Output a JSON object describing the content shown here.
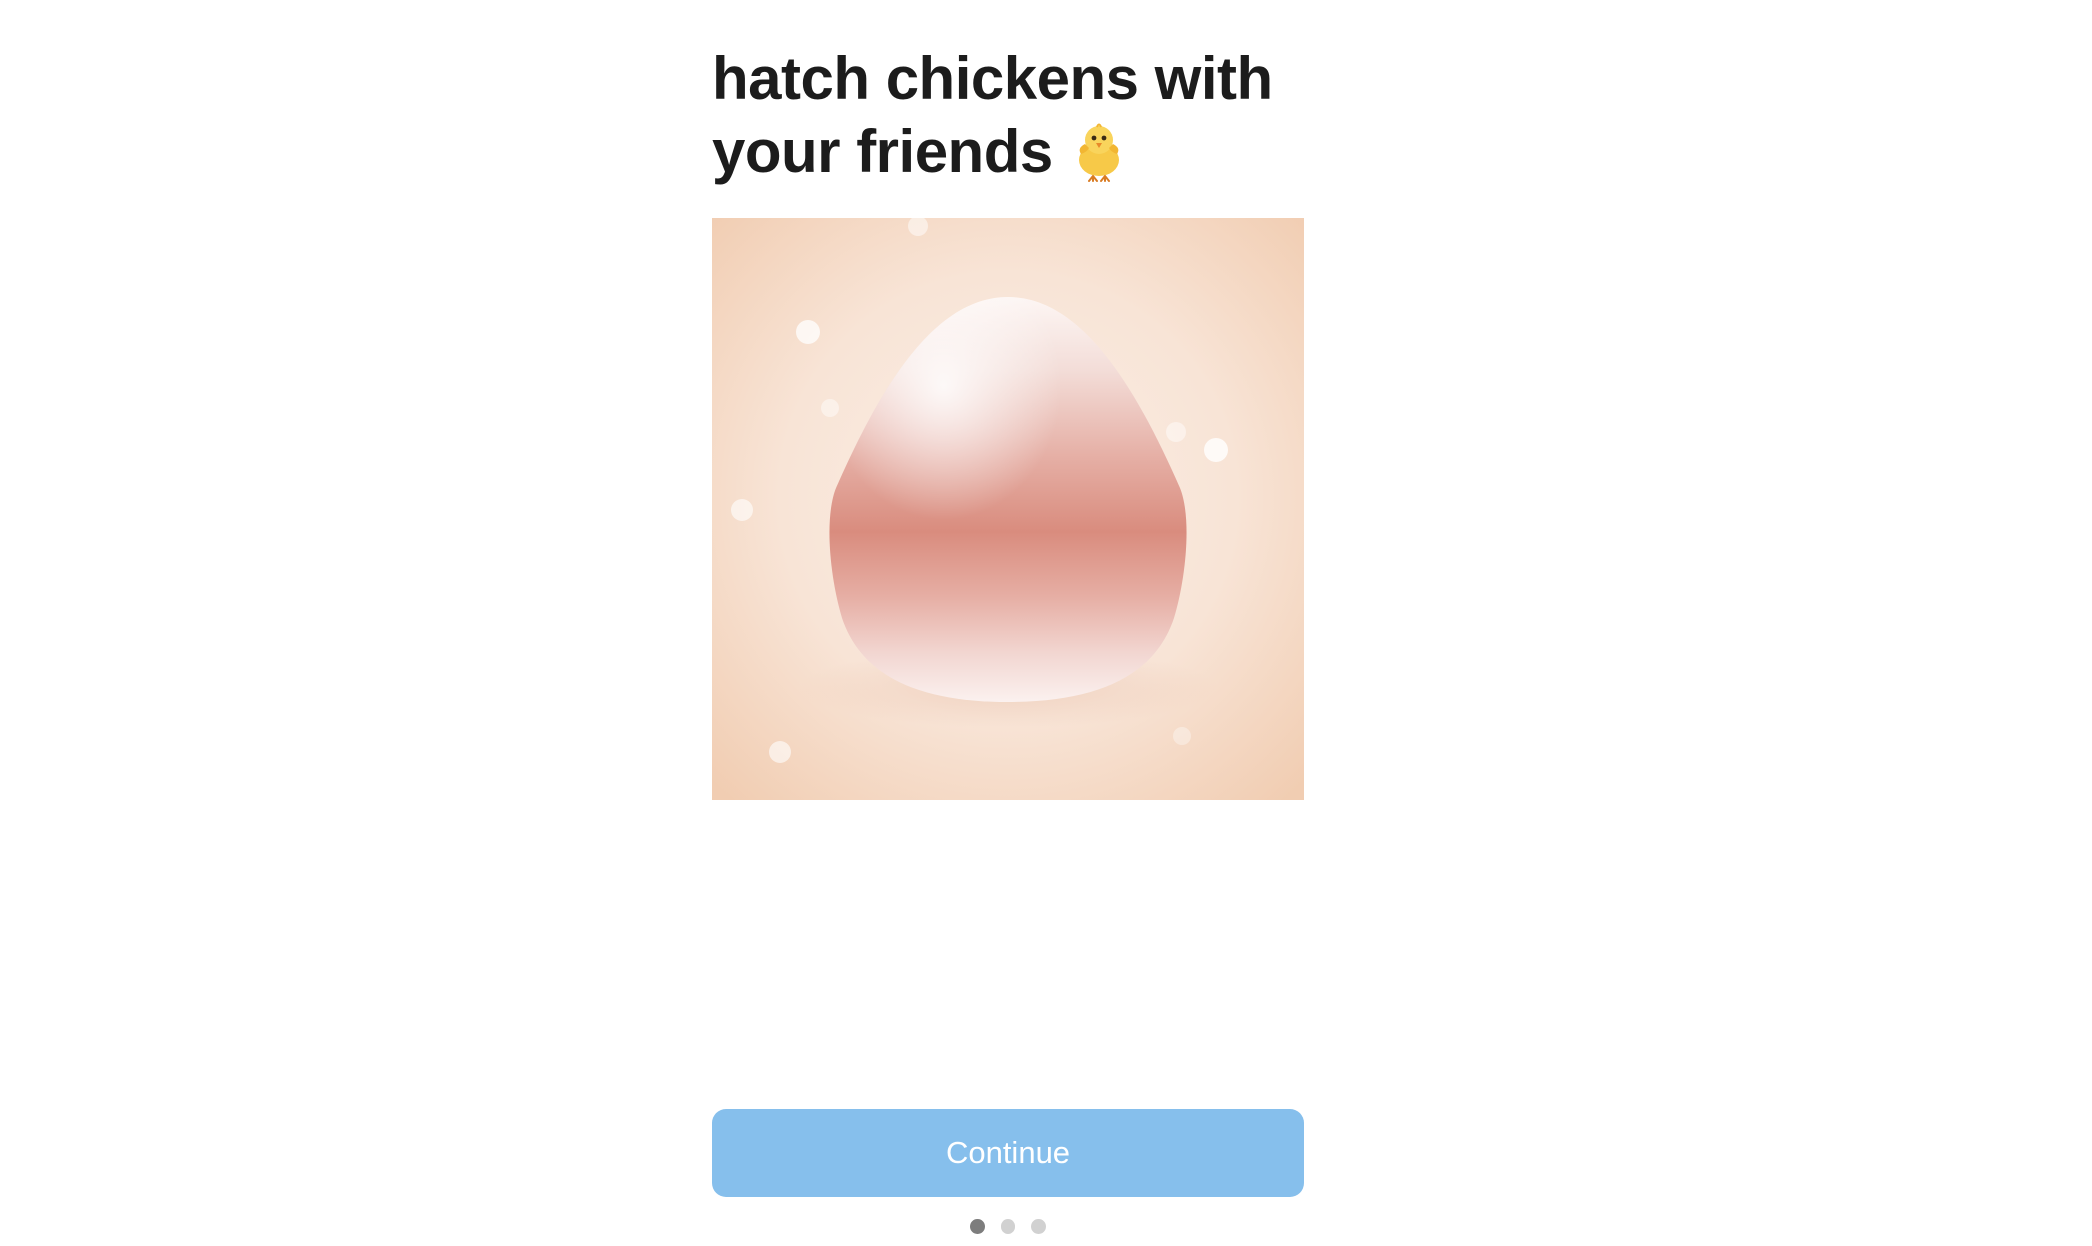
{
  "onboarding": {
    "title_line_1": "hatch chickens with",
    "title_line_2": "your friends",
    "title_emoji": "hatching-chick-icon",
    "illustration": "egg-icon",
    "continue_label": "Continue"
  },
  "pager": {
    "total_pages": 3,
    "current_page": 1
  },
  "colors": {
    "button": "#86bfec",
    "background_peach": "#f6e0cf",
    "egg_band": "#d98c7e",
    "title_text": "#1c1c1c"
  }
}
